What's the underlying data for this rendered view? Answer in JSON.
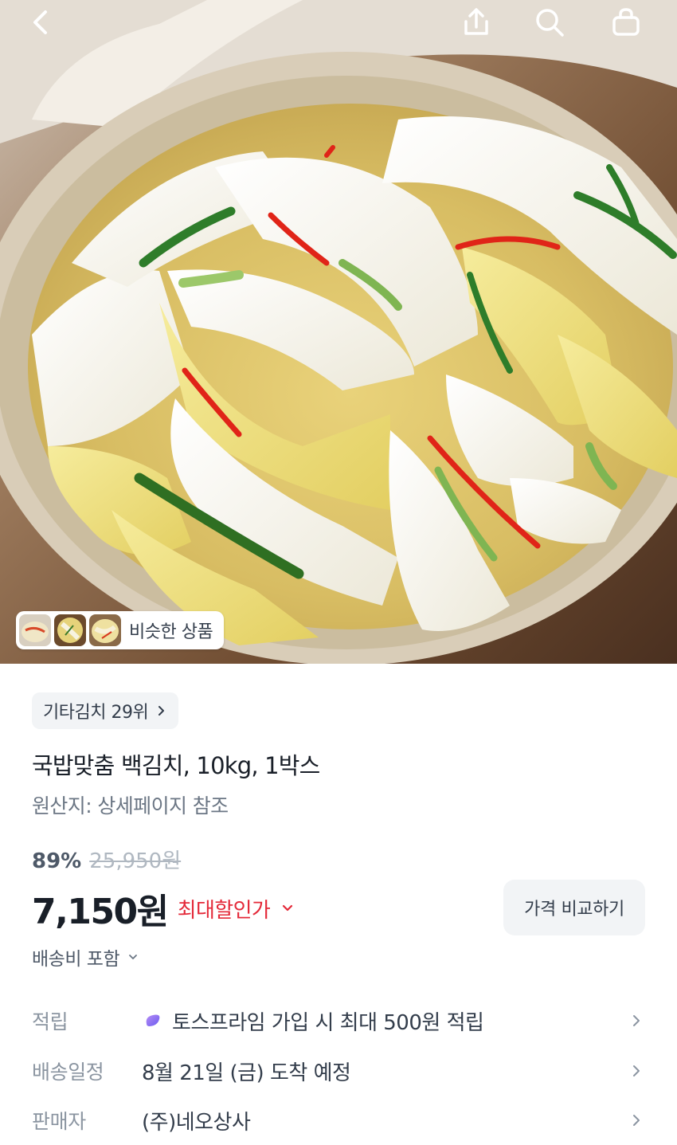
{
  "similar_chip": {
    "label": "비슷한 상품"
  },
  "category_rank": {
    "label": "기타김치 29위"
  },
  "product": {
    "title": "국밥맞춤 백김치, 10kg, 1박스",
    "origin": "원산지: 상세페이지 참조"
  },
  "pricing": {
    "discount_percent": "89%",
    "original_price": "25,950원",
    "price": "7,150원",
    "max_discount_label": "최대할인가",
    "compare_label": "가격 비교하기",
    "shipping_fee_label": "배송비 포함"
  },
  "info_rows": [
    {
      "key": "적립",
      "value": "토스프라임 가입 시 최대 500원 적립"
    },
    {
      "key": "배송일정",
      "value": "8월 21일 (금) 도착 예정"
    },
    {
      "key": "판매자",
      "value": "(주)네오상사"
    }
  ],
  "colors": {
    "accent_red": "#e42939",
    "chip_bg": "#f2f4f6",
    "text_primary": "#191f28",
    "text_secondary": "#6b7684"
  }
}
